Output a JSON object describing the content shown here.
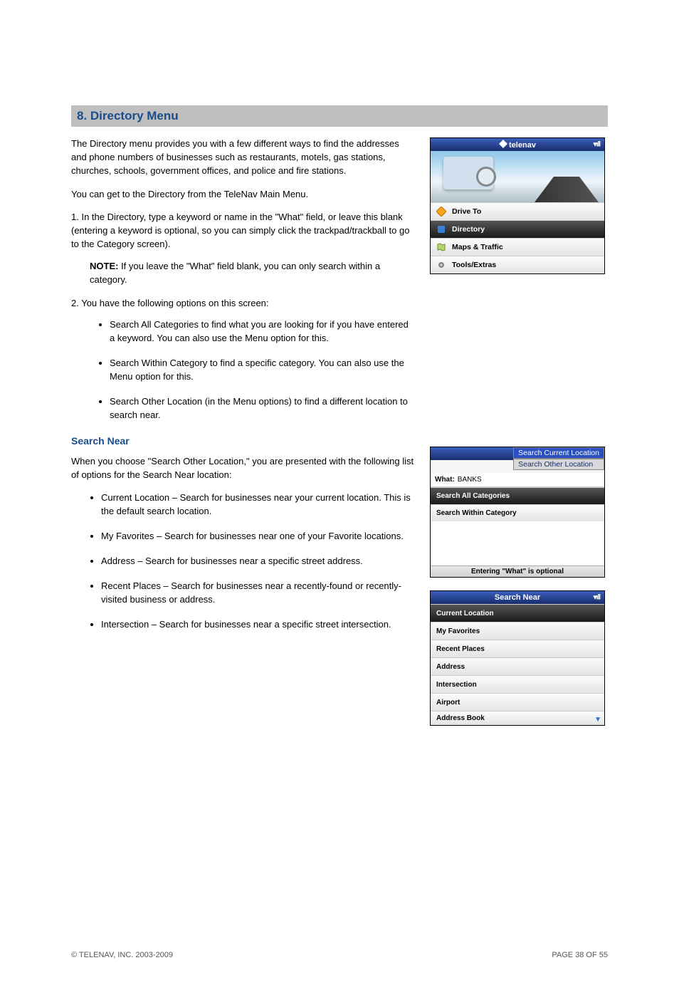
{
  "section_title": "8. Directory Menu",
  "intro": "The Directory menu provides you with a few different ways to find the addresses and phone numbers of businesses such as restaurants, motels, gas stations, churches, schools, government offices, and police and fire stations.",
  "menu_access": "You can get to the Directory from the TeleNav Main Menu.",
  "step1": "1.   In the Directory, type a keyword or name in the \"What\" field, or leave this blank (entering a keyword is optional, so you can simply click the trackpad/trackball to go to the Category screen).",
  "step1_note_label": "NOTE:",
  "step1_note": " If you leave the \"What\" field blank, you can only search within a category.",
  "step2": "2.   You have the following options on this screen:",
  "bullets": [
    "Search All Categories to find what you are looking for if you have entered a keyword. You can also use the Menu option for this.",
    "Search Within Category to find a specific category. You can also use the Menu option for this.",
    "Search Other Location (in the Menu options) to find a different location to search near."
  ],
  "heading2": "Search Near",
  "search_near_intro": "When you choose \"Search Other Location,\" you are presented with the following list of options for the Search Near location:",
  "search_near_list": [
    "Current Location – Search for businesses near your current location. This is the default search location.",
    "My Favorites – Search for businesses near one of your Favorite locations.",
    "Address – Search for businesses near a specific street address.",
    "Recent Places – Search for businesses near a recently-found or recently-visited business or address.",
    "Intersection – Search for businesses near a specific street intersection."
  ],
  "footer_left": "© TELENAV, INC. 2003-2009",
  "footer_right": "PAGE 38 OF 55",
  "dev1": {
    "brand": "telenav",
    "items": [
      "Drive To",
      "Directory",
      "Maps & Traffic",
      "Tools/Extras"
    ],
    "selected": 1,
    "signal": "▾ıll"
  },
  "dev2": {
    "popup_hot": "Search Current Location",
    "popup_other": "Search Other Location",
    "what_label": "What:",
    "what_value": "BANKS",
    "rows": [
      "Search All Categories",
      "Search Within Category"
    ],
    "selected": 0,
    "hint": "Entering \"What\" is optional"
  },
  "dev3": {
    "title": "Search Near",
    "signal": "▾ıll",
    "items": [
      "Current Location",
      "My Favorites",
      "Recent Places",
      "Address",
      "Intersection",
      "Airport",
      "Address Book"
    ],
    "selected": 0
  }
}
